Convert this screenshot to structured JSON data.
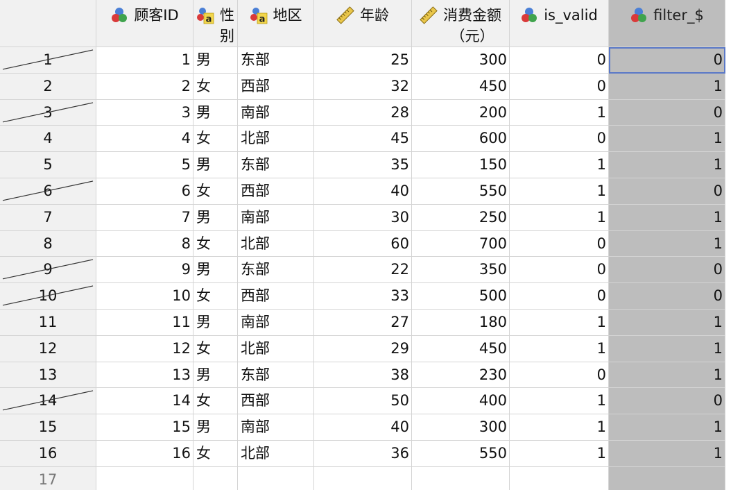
{
  "colors": {
    "header_bg": "#f1f1f1",
    "grid_line": "#d4d4d4",
    "filter_col_bg": "#bdbdbd",
    "active_border": "#5a78c7"
  },
  "columns": [
    {
      "key": "id",
      "label": "顾客ID",
      "icon": "nominal-icon",
      "align": "right"
    },
    {
      "key": "gender",
      "label": "性\n别",
      "icon": "string-nominal-icon",
      "align": "left"
    },
    {
      "key": "region",
      "label": "地区",
      "icon": "string-nominal-icon",
      "align": "left"
    },
    {
      "key": "age",
      "label": "年龄",
      "icon": "scale-ruler-icon",
      "align": "right"
    },
    {
      "key": "spend",
      "label": "消费金额\n（元）",
      "icon": "scale-ruler-icon",
      "align": "right"
    },
    {
      "key": "is_valid",
      "label": "is_valid",
      "icon": "nominal-icon",
      "align": "right"
    },
    {
      "key": "filter",
      "label": "filter_$",
      "icon": "nominal-icon",
      "align": "right"
    }
  ],
  "rows": [
    {
      "n": "1",
      "id": "1",
      "gender": "男",
      "region": "东部",
      "age": "25",
      "spend": "300",
      "is_valid": "0",
      "filter": "0"
    },
    {
      "n": "2",
      "id": "2",
      "gender": "女",
      "region": "西部",
      "age": "32",
      "spend": "450",
      "is_valid": "0",
      "filter": "1"
    },
    {
      "n": "3",
      "id": "3",
      "gender": "男",
      "region": "南部",
      "age": "28",
      "spend": "200",
      "is_valid": "1",
      "filter": "0"
    },
    {
      "n": "4",
      "id": "4",
      "gender": "女",
      "region": "北部",
      "age": "45",
      "spend": "600",
      "is_valid": "0",
      "filter": "1"
    },
    {
      "n": "5",
      "id": "5",
      "gender": "男",
      "region": "东部",
      "age": "35",
      "spend": "150",
      "is_valid": "1",
      "filter": "1"
    },
    {
      "n": "6",
      "id": "6",
      "gender": "女",
      "region": "西部",
      "age": "40",
      "spend": "550",
      "is_valid": "1",
      "filter": "0"
    },
    {
      "n": "7",
      "id": "7",
      "gender": "男",
      "region": "南部",
      "age": "30",
      "spend": "250",
      "is_valid": "1",
      "filter": "1"
    },
    {
      "n": "8",
      "id": "8",
      "gender": "女",
      "region": "北部",
      "age": "60",
      "spend": "700",
      "is_valid": "0",
      "filter": "1"
    },
    {
      "n": "9",
      "id": "9",
      "gender": "男",
      "region": "东部",
      "age": "22",
      "spend": "350",
      "is_valid": "0",
      "filter": "0"
    },
    {
      "n": "10",
      "id": "10",
      "gender": "女",
      "region": "西部",
      "age": "33",
      "spend": "500",
      "is_valid": "0",
      "filter": "0"
    },
    {
      "n": "11",
      "id": "11",
      "gender": "男",
      "region": "南部",
      "age": "27",
      "spend": "180",
      "is_valid": "1",
      "filter": "1"
    },
    {
      "n": "12",
      "id": "12",
      "gender": "女",
      "region": "北部",
      "age": "29",
      "spend": "450",
      "is_valid": "1",
      "filter": "1"
    },
    {
      "n": "13",
      "id": "13",
      "gender": "男",
      "region": "东部",
      "age": "38",
      "spend": "230",
      "is_valid": "0",
      "filter": "1"
    },
    {
      "n": "14",
      "id": "14",
      "gender": "女",
      "region": "西部",
      "age": "50",
      "spend": "400",
      "is_valid": "1",
      "filter": "0"
    },
    {
      "n": "15",
      "id": "15",
      "gender": "男",
      "region": "南部",
      "age": "40",
      "spend": "300",
      "is_valid": "1",
      "filter": "1"
    },
    {
      "n": "16",
      "id": "16",
      "gender": "女",
      "region": "北部",
      "age": "36",
      "spend": "550",
      "is_valid": "1",
      "filter": "1"
    },
    {
      "n": "17",
      "id": "",
      "gender": "",
      "region": "",
      "age": "",
      "spend": "",
      "is_valid": "",
      "filter": ""
    }
  ]
}
